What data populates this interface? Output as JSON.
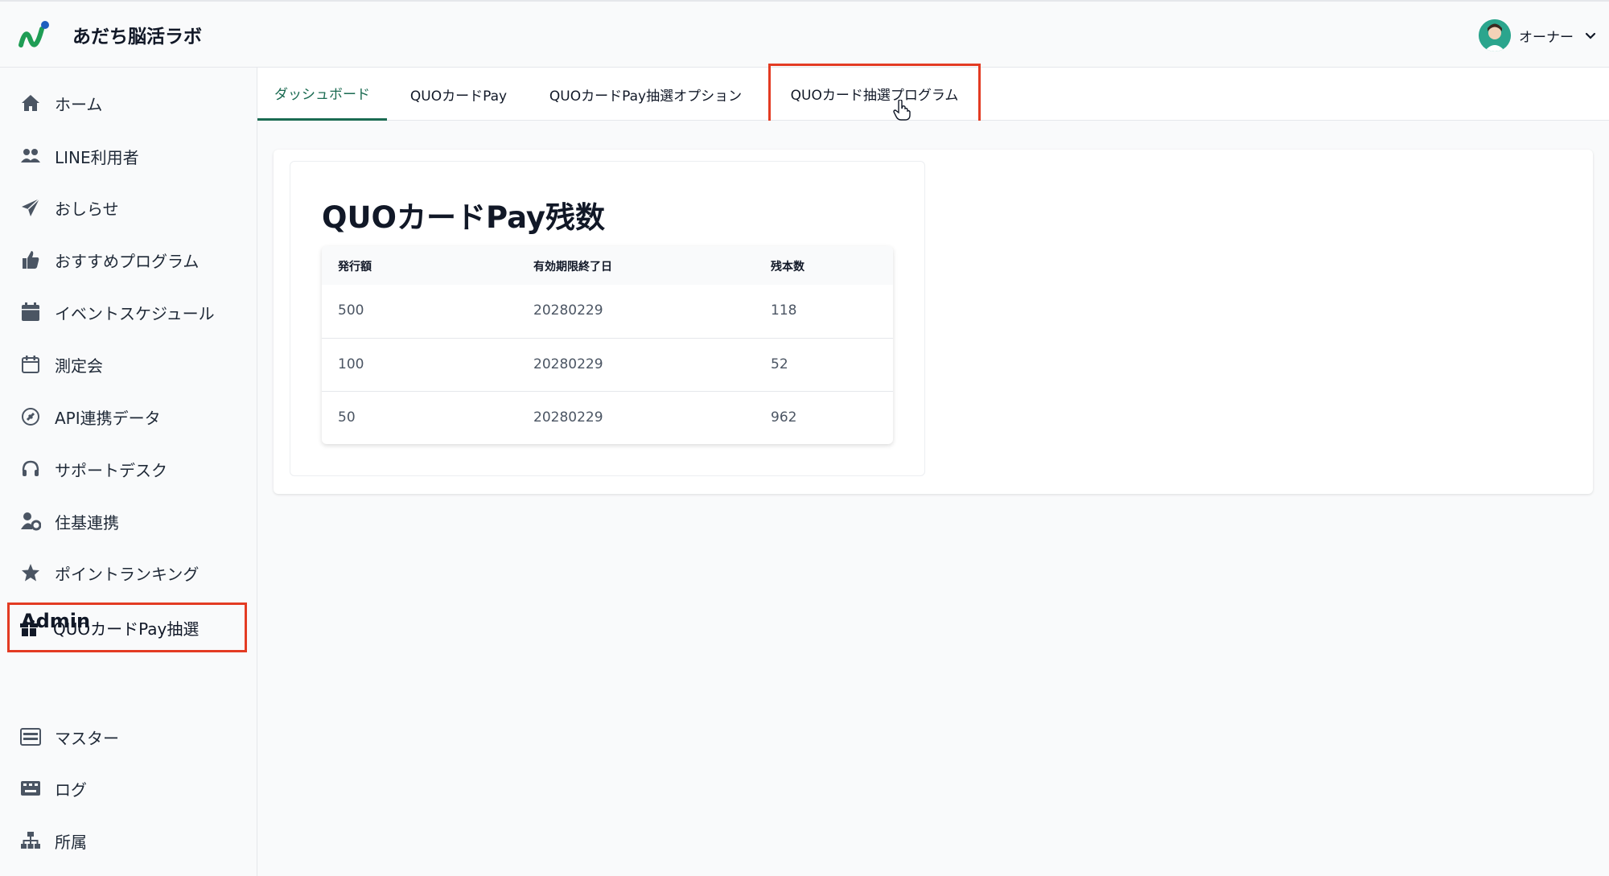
{
  "app": {
    "title": "あだち脳活ラボ",
    "user_name": "オーナー"
  },
  "sidebar": {
    "items": [
      {
        "label": "ホーム",
        "icon": "home-icon"
      },
      {
        "label": "LINE利用者",
        "icon": "users-icon"
      },
      {
        "label": "おしらせ",
        "icon": "paper-plane-icon"
      },
      {
        "label": "おすすめプログラム",
        "icon": "thumbs-up-icon"
      },
      {
        "label": "イベントスケジュール",
        "icon": "calendar-filled-icon"
      },
      {
        "label": "測定会",
        "icon": "calendar-outline-icon"
      },
      {
        "label": "API連携データ",
        "icon": "plug-icon"
      },
      {
        "label": "サポートデスク",
        "icon": "headset-icon"
      },
      {
        "label": "住基連携",
        "icon": "user-gear-icon"
      },
      {
        "label": "ポイントランキング",
        "icon": "star-icon"
      },
      {
        "label": "QUOカードPay抽選",
        "icon": "gift-icon"
      }
    ],
    "admin_label": "Admin",
    "admin_items": [
      {
        "label": "マスター",
        "icon": "server-icon"
      },
      {
        "label": "ログ",
        "icon": "keyboard-icon"
      },
      {
        "label": "所属",
        "icon": "sitemap-icon"
      }
    ]
  },
  "tabs": [
    {
      "label": "ダッシュボード"
    },
    {
      "label": "QUOカードPay"
    },
    {
      "label": "QUOカードPay抽選オプション"
    },
    {
      "label": "QUOカード抽選プログラム"
    }
  ],
  "main": {
    "card_title": "QUOカードPay残数",
    "table": {
      "headers": [
        "発行額",
        "有効期限終了日",
        "残本数"
      ],
      "rows": [
        [
          "500",
          "20280229",
          "118"
        ],
        [
          "100",
          "20280229",
          "52"
        ],
        [
          "50",
          "20280229",
          "962"
        ]
      ]
    }
  },
  "colors": {
    "accent": "#1b6b52",
    "highlight_box": "#e33b23",
    "avatar_bg": "#2ba58d"
  }
}
